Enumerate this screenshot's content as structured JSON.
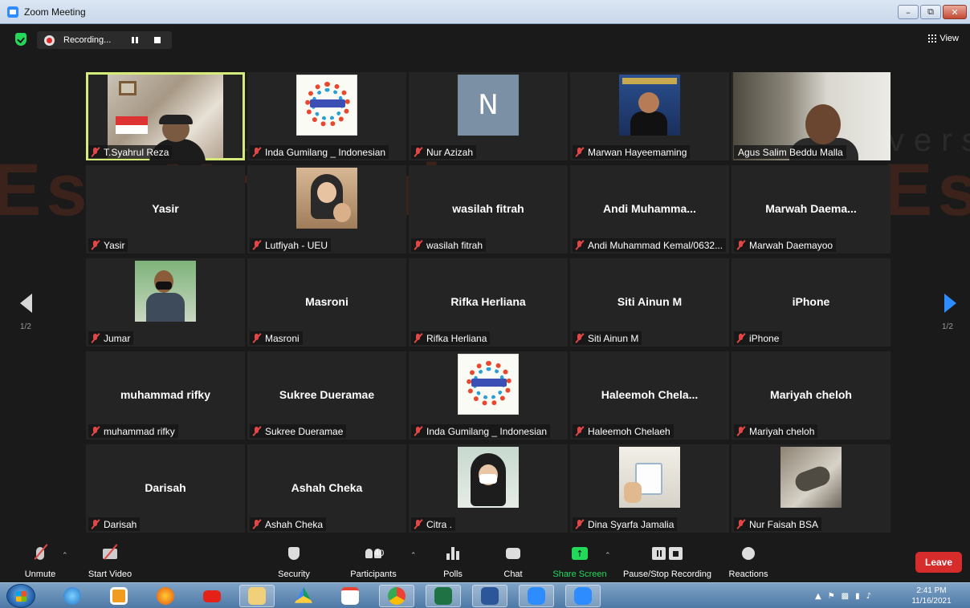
{
  "window": {
    "title": "Zoom Meeting",
    "controls": [
      "minimize",
      "restore",
      "close"
    ]
  },
  "topbar": {
    "recording_label": "Recording...",
    "view_label": "View"
  },
  "watermark": {
    "line1": "Universitas",
    "line2": "Esa Unggul",
    "line3": "Universitas",
    "line4": "Esa"
  },
  "pagination": {
    "left": "1/2",
    "right": "1/2"
  },
  "participants": [
    {
      "name": "T.Syahrul Reza",
      "big": "",
      "media": "video",
      "active": true,
      "muted": true
    },
    {
      "name": "Inda Gumilang _ Indonesian",
      "big": "",
      "media": "poster",
      "muted": true
    },
    {
      "name": "Nur Azizah",
      "big": "",
      "media": "initial",
      "initial": "N",
      "muted": true
    },
    {
      "name": "Marwan Hayeemaming",
      "big": "",
      "media": "arabic",
      "muted": true
    },
    {
      "name": "Agus Salim Beddu Malla",
      "big": "",
      "media": "agus",
      "muted": false
    },
    {
      "name": "Yasir",
      "big": "Yasir",
      "media": "none",
      "muted": true
    },
    {
      "name": "Lutfiyah - UEU",
      "big": "",
      "media": "lutfiyah",
      "muted": true
    },
    {
      "name": "wasilah fitrah",
      "big": "wasilah fitrah",
      "media": "none",
      "muted": true
    },
    {
      "name": "Andi Muhammad Kemal/0632...",
      "big": "Andi  Muhamma...",
      "media": "none",
      "muted": true
    },
    {
      "name": "Marwah Daemayoo",
      "big": "Marwah  Daema...",
      "media": "none",
      "muted": true
    },
    {
      "name": "Jumar",
      "big": "",
      "media": "jumar",
      "muted": true
    },
    {
      "name": "Masroni",
      "big": "Masroni",
      "media": "none",
      "muted": true
    },
    {
      "name": "Rifka Herliana",
      "big": "Rifka Herliana",
      "media": "none",
      "muted": true
    },
    {
      "name": "Siti Ainun M",
      "big": "Siti Ainun M",
      "media": "none",
      "muted": true
    },
    {
      "name": "iPhone",
      "big": "iPhone",
      "media": "none",
      "muted": true
    },
    {
      "name": "muhammad rifky",
      "big": "muhammad rifky",
      "media": "none",
      "muted": true
    },
    {
      "name": "Sukree Dueramae",
      "big": "Sukree Dueramae",
      "media": "none",
      "muted": true
    },
    {
      "name": "Inda Gumilang _ Indonesian",
      "big": "",
      "media": "poster",
      "muted": true
    },
    {
      "name": "Haleemoh Chelaeh",
      "big": "Haleemoh  Chela...",
      "media": "none",
      "muted": true
    },
    {
      "name": "Mariyah cheloh",
      "big": "Mariyah cheloh",
      "media": "none",
      "muted": true
    },
    {
      "name": "Darisah",
      "big": "Darisah",
      "media": "none",
      "muted": true
    },
    {
      "name": "Ashah Cheka",
      "big": "Ashah Cheka",
      "media": "none",
      "muted": true
    },
    {
      "name": "Citra .",
      "big": "",
      "media": "citra",
      "muted": true
    },
    {
      "name": "Dina Syarfa Jamalia",
      "big": "",
      "media": "dina",
      "muted": true
    },
    {
      "name": "Nur Faisah BSA",
      "big": "",
      "media": "faisah",
      "muted": true
    }
  ],
  "toolbar": {
    "unmute": "Unmute",
    "start_video": "Start Video",
    "security": "Security",
    "participants": "Participants",
    "participants_count": "40",
    "polls": "Polls",
    "chat": "Chat",
    "share_screen": "Share Screen",
    "pause_stop_recording": "Pause/Stop Recording",
    "reactions": "Reactions",
    "leave": "Leave"
  },
  "colors": {
    "accent_blue": "#2d8cff",
    "active_outline": "#d6ec7a",
    "share_green": "#23d959",
    "leave_red": "#d72c2c",
    "muted_red": "#e34646"
  },
  "taskbar": {
    "apps": [
      "start-orb",
      "internet-explorer",
      "media-player",
      "firefox",
      "youtube",
      "file-explorer",
      "google-drive",
      "gmail",
      "chrome",
      "excel",
      "word",
      "zoom",
      "zoom"
    ],
    "clock_time": "2:41 PM",
    "clock_date": "11/16/2021"
  }
}
